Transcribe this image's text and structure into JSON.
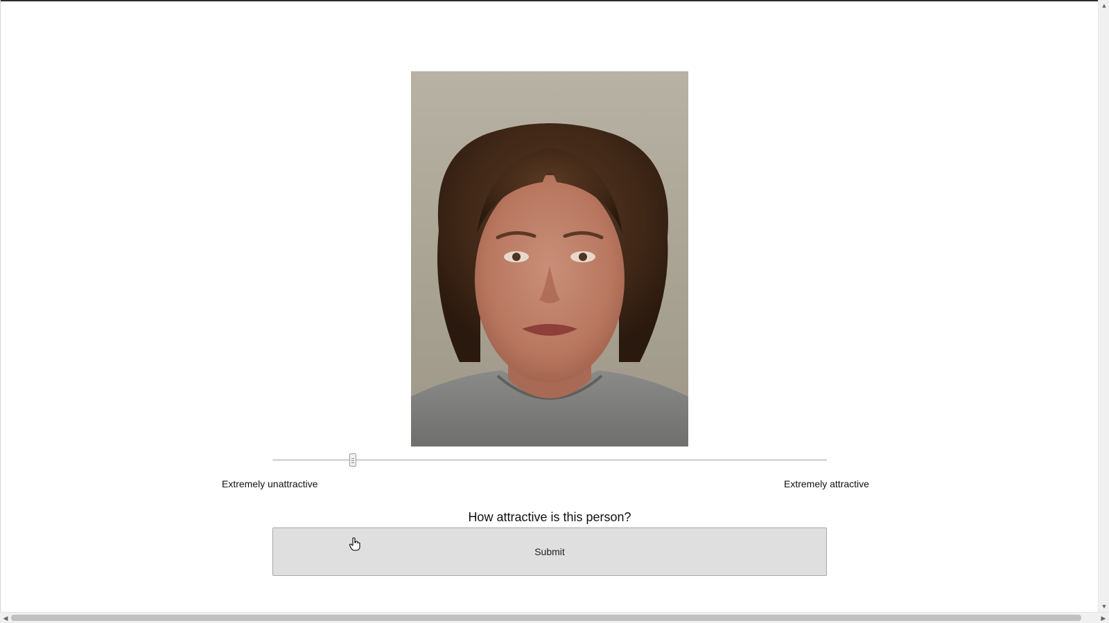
{
  "survey": {
    "question": "How attractive is this person?",
    "scale_min_label": "Extremely unattractive",
    "scale_max_label": "Extremely attractive",
    "rating_fraction": 0.145,
    "submit_label": "Submit"
  },
  "photo": {
    "subject": "portrait-photo"
  },
  "cursor": {
    "icon": "hand-pointer-icon"
  },
  "scrollbars": {
    "up_arrow": "▲",
    "down_arrow": "▼",
    "left_arrow": "◀",
    "right_arrow": "▶"
  }
}
